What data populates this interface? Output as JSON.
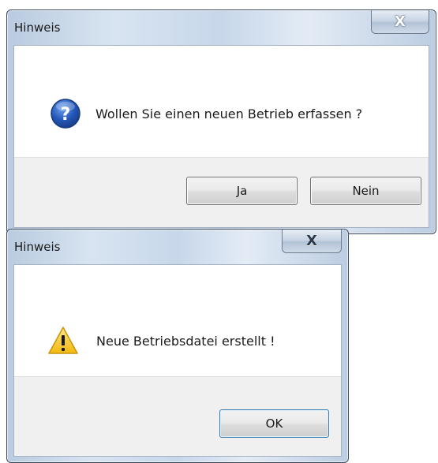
{
  "dialog_confirm": {
    "title": "Hinweis",
    "message": "Wollen Sie einen neuen Betrieb erfassen ?",
    "icon": "question-icon",
    "close_label": "X",
    "yes_label": "Ja",
    "no_label": "Nein"
  },
  "dialog_info": {
    "title": "Hinweis",
    "message": "Neue Betriebsdatei erstellt !",
    "icon": "warning-icon",
    "close_label": "X",
    "ok_label": "OK"
  },
  "colors": {
    "question_icon": "#2458b8",
    "warning_icon": "#f2c21a",
    "default_button_border": "#3c7fb1"
  }
}
